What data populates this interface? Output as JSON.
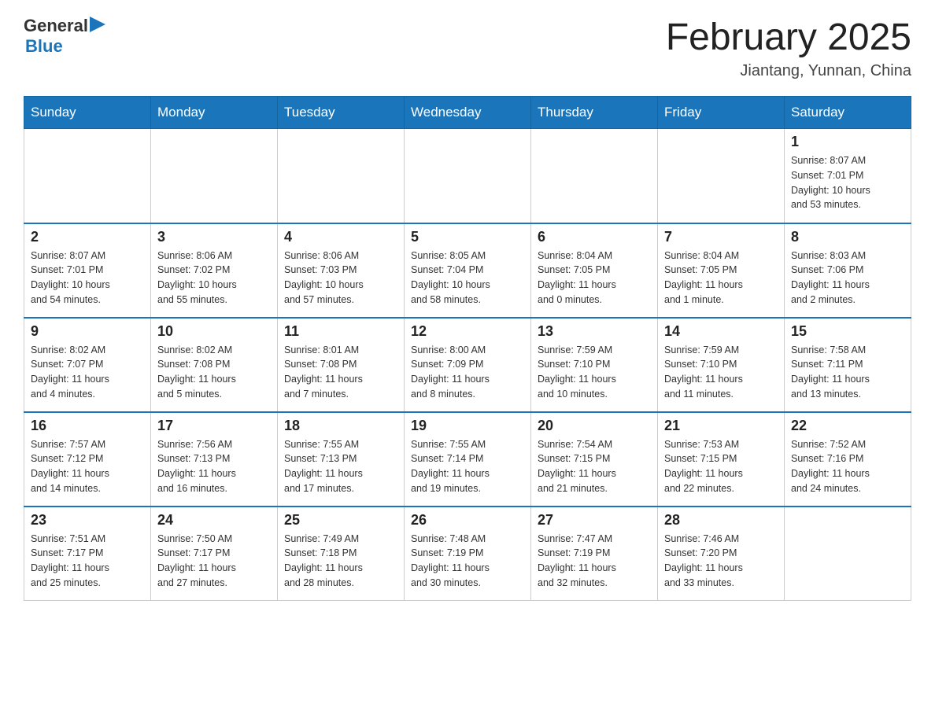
{
  "logo": {
    "general": "General",
    "arrow": "▶",
    "blue": "Blue"
  },
  "title": "February 2025",
  "subtitle": "Jiantang, Yunnan, China",
  "weekdays": [
    "Sunday",
    "Monday",
    "Tuesday",
    "Wednesday",
    "Thursday",
    "Friday",
    "Saturday"
  ],
  "weeks": [
    [
      {
        "day": "",
        "info": ""
      },
      {
        "day": "",
        "info": ""
      },
      {
        "day": "",
        "info": ""
      },
      {
        "day": "",
        "info": ""
      },
      {
        "day": "",
        "info": ""
      },
      {
        "day": "",
        "info": ""
      },
      {
        "day": "1",
        "info": "Sunrise: 8:07 AM\nSunset: 7:01 PM\nDaylight: 10 hours\nand 53 minutes."
      }
    ],
    [
      {
        "day": "2",
        "info": "Sunrise: 8:07 AM\nSunset: 7:01 PM\nDaylight: 10 hours\nand 54 minutes."
      },
      {
        "day": "3",
        "info": "Sunrise: 8:06 AM\nSunset: 7:02 PM\nDaylight: 10 hours\nand 55 minutes."
      },
      {
        "day": "4",
        "info": "Sunrise: 8:06 AM\nSunset: 7:03 PM\nDaylight: 10 hours\nand 57 minutes."
      },
      {
        "day": "5",
        "info": "Sunrise: 8:05 AM\nSunset: 7:04 PM\nDaylight: 10 hours\nand 58 minutes."
      },
      {
        "day": "6",
        "info": "Sunrise: 8:04 AM\nSunset: 7:05 PM\nDaylight: 11 hours\nand 0 minutes."
      },
      {
        "day": "7",
        "info": "Sunrise: 8:04 AM\nSunset: 7:05 PM\nDaylight: 11 hours\nand 1 minute."
      },
      {
        "day": "8",
        "info": "Sunrise: 8:03 AM\nSunset: 7:06 PM\nDaylight: 11 hours\nand 2 minutes."
      }
    ],
    [
      {
        "day": "9",
        "info": "Sunrise: 8:02 AM\nSunset: 7:07 PM\nDaylight: 11 hours\nand 4 minutes."
      },
      {
        "day": "10",
        "info": "Sunrise: 8:02 AM\nSunset: 7:08 PM\nDaylight: 11 hours\nand 5 minutes."
      },
      {
        "day": "11",
        "info": "Sunrise: 8:01 AM\nSunset: 7:08 PM\nDaylight: 11 hours\nand 7 minutes."
      },
      {
        "day": "12",
        "info": "Sunrise: 8:00 AM\nSunset: 7:09 PM\nDaylight: 11 hours\nand 8 minutes."
      },
      {
        "day": "13",
        "info": "Sunrise: 7:59 AM\nSunset: 7:10 PM\nDaylight: 11 hours\nand 10 minutes."
      },
      {
        "day": "14",
        "info": "Sunrise: 7:59 AM\nSunset: 7:10 PM\nDaylight: 11 hours\nand 11 minutes."
      },
      {
        "day": "15",
        "info": "Sunrise: 7:58 AM\nSunset: 7:11 PM\nDaylight: 11 hours\nand 13 minutes."
      }
    ],
    [
      {
        "day": "16",
        "info": "Sunrise: 7:57 AM\nSunset: 7:12 PM\nDaylight: 11 hours\nand 14 minutes."
      },
      {
        "day": "17",
        "info": "Sunrise: 7:56 AM\nSunset: 7:13 PM\nDaylight: 11 hours\nand 16 minutes."
      },
      {
        "day": "18",
        "info": "Sunrise: 7:55 AM\nSunset: 7:13 PM\nDaylight: 11 hours\nand 17 minutes."
      },
      {
        "day": "19",
        "info": "Sunrise: 7:55 AM\nSunset: 7:14 PM\nDaylight: 11 hours\nand 19 minutes."
      },
      {
        "day": "20",
        "info": "Sunrise: 7:54 AM\nSunset: 7:15 PM\nDaylight: 11 hours\nand 21 minutes."
      },
      {
        "day": "21",
        "info": "Sunrise: 7:53 AM\nSunset: 7:15 PM\nDaylight: 11 hours\nand 22 minutes."
      },
      {
        "day": "22",
        "info": "Sunrise: 7:52 AM\nSunset: 7:16 PM\nDaylight: 11 hours\nand 24 minutes."
      }
    ],
    [
      {
        "day": "23",
        "info": "Sunrise: 7:51 AM\nSunset: 7:17 PM\nDaylight: 11 hours\nand 25 minutes."
      },
      {
        "day": "24",
        "info": "Sunrise: 7:50 AM\nSunset: 7:17 PM\nDaylight: 11 hours\nand 27 minutes."
      },
      {
        "day": "25",
        "info": "Sunrise: 7:49 AM\nSunset: 7:18 PM\nDaylight: 11 hours\nand 28 minutes."
      },
      {
        "day": "26",
        "info": "Sunrise: 7:48 AM\nSunset: 7:19 PM\nDaylight: 11 hours\nand 30 minutes."
      },
      {
        "day": "27",
        "info": "Sunrise: 7:47 AM\nSunset: 7:19 PM\nDaylight: 11 hours\nand 32 minutes."
      },
      {
        "day": "28",
        "info": "Sunrise: 7:46 AM\nSunset: 7:20 PM\nDaylight: 11 hours\nand 33 minutes."
      },
      {
        "day": "",
        "info": ""
      }
    ]
  ]
}
